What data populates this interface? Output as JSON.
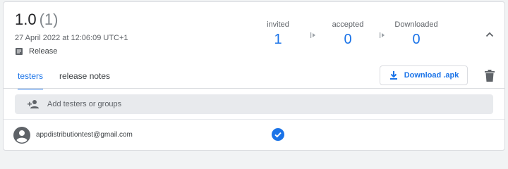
{
  "release": {
    "version": "1.0",
    "count": "(1)",
    "date": "27 April 2022 at 12:06:09 UTC+1",
    "type_label": "Release"
  },
  "stats": {
    "invited_label": "invited",
    "invited_value": "1",
    "accepted_label": "accepted",
    "accepted_value": "0",
    "downloaded_label": "Downloaded",
    "downloaded_value": "0"
  },
  "tabs": {
    "testers": "testers",
    "release_notes": "release notes",
    "active": "testers"
  },
  "actions": {
    "download_label": "Download .apk"
  },
  "add_testers": {
    "placeholder": "Add testers or groups"
  },
  "testers": [
    {
      "email": "appdistributiontest@gmail.com",
      "status_icon": "check-circle-icon"
    }
  ],
  "colors": {
    "accent": "#1a73e8",
    "text_secondary": "#5f6368",
    "border": "#dadce0",
    "input_bg": "#e8eaed"
  },
  "icons": {
    "release": "notes-icon",
    "arrow": "funnel-arrow-icon",
    "collapse": "chevron-up-icon",
    "download": "download-icon",
    "delete": "trash-icon",
    "add_person": "person-add-icon",
    "avatar": "account-circle-icon"
  }
}
